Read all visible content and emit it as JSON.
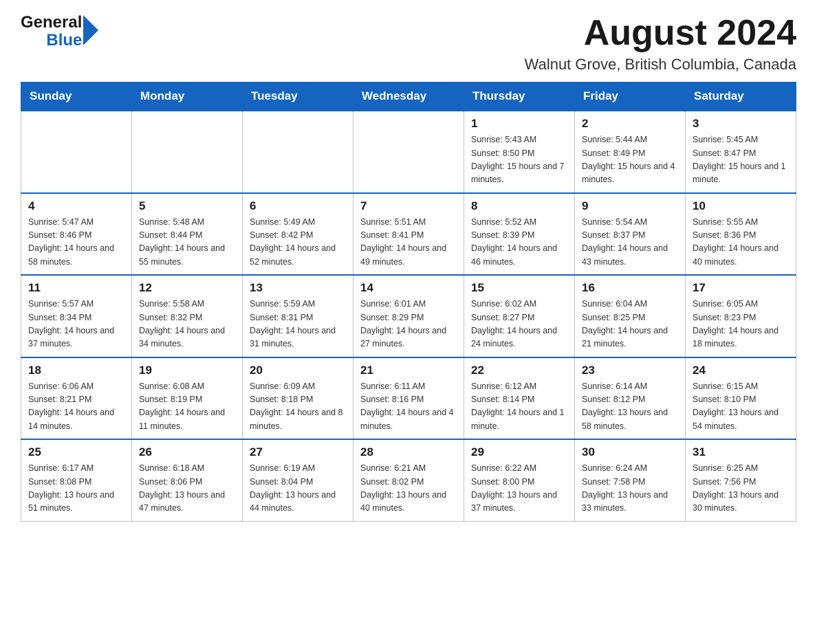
{
  "header": {
    "logo_text_general": "General",
    "logo_text_blue": "Blue",
    "title": "August 2024",
    "subtitle": "Walnut Grove, British Columbia, Canada"
  },
  "days_of_week": [
    "Sunday",
    "Monday",
    "Tuesday",
    "Wednesday",
    "Thursday",
    "Friday",
    "Saturday"
  ],
  "weeks": [
    {
      "days": [
        {
          "num": "",
          "info": "",
          "empty": true
        },
        {
          "num": "",
          "info": "",
          "empty": true
        },
        {
          "num": "",
          "info": "",
          "empty": true
        },
        {
          "num": "",
          "info": "",
          "empty": true
        },
        {
          "num": "1",
          "info": "Sunrise: 5:43 AM\nSunset: 8:50 PM\nDaylight: 15 hours and 7 minutes.",
          "empty": false
        },
        {
          "num": "2",
          "info": "Sunrise: 5:44 AM\nSunset: 8:49 PM\nDaylight: 15 hours and 4 minutes.",
          "empty": false
        },
        {
          "num": "3",
          "info": "Sunrise: 5:45 AM\nSunset: 8:47 PM\nDaylight: 15 hours and 1 minute.",
          "empty": false
        }
      ]
    },
    {
      "days": [
        {
          "num": "4",
          "info": "Sunrise: 5:47 AM\nSunset: 8:46 PM\nDaylight: 14 hours and 58 minutes.",
          "empty": false
        },
        {
          "num": "5",
          "info": "Sunrise: 5:48 AM\nSunset: 8:44 PM\nDaylight: 14 hours and 55 minutes.",
          "empty": false
        },
        {
          "num": "6",
          "info": "Sunrise: 5:49 AM\nSunset: 8:42 PM\nDaylight: 14 hours and 52 minutes.",
          "empty": false
        },
        {
          "num": "7",
          "info": "Sunrise: 5:51 AM\nSunset: 8:41 PM\nDaylight: 14 hours and 49 minutes.",
          "empty": false
        },
        {
          "num": "8",
          "info": "Sunrise: 5:52 AM\nSunset: 8:39 PM\nDaylight: 14 hours and 46 minutes.",
          "empty": false
        },
        {
          "num": "9",
          "info": "Sunrise: 5:54 AM\nSunset: 8:37 PM\nDaylight: 14 hours and 43 minutes.",
          "empty": false
        },
        {
          "num": "10",
          "info": "Sunrise: 5:55 AM\nSunset: 8:36 PM\nDaylight: 14 hours and 40 minutes.",
          "empty": false
        }
      ]
    },
    {
      "days": [
        {
          "num": "11",
          "info": "Sunrise: 5:57 AM\nSunset: 8:34 PM\nDaylight: 14 hours and 37 minutes.",
          "empty": false
        },
        {
          "num": "12",
          "info": "Sunrise: 5:58 AM\nSunset: 8:32 PM\nDaylight: 14 hours and 34 minutes.",
          "empty": false
        },
        {
          "num": "13",
          "info": "Sunrise: 5:59 AM\nSunset: 8:31 PM\nDaylight: 14 hours and 31 minutes.",
          "empty": false
        },
        {
          "num": "14",
          "info": "Sunrise: 6:01 AM\nSunset: 8:29 PM\nDaylight: 14 hours and 27 minutes.",
          "empty": false
        },
        {
          "num": "15",
          "info": "Sunrise: 6:02 AM\nSunset: 8:27 PM\nDaylight: 14 hours and 24 minutes.",
          "empty": false
        },
        {
          "num": "16",
          "info": "Sunrise: 6:04 AM\nSunset: 8:25 PM\nDaylight: 14 hours and 21 minutes.",
          "empty": false
        },
        {
          "num": "17",
          "info": "Sunrise: 6:05 AM\nSunset: 8:23 PM\nDaylight: 14 hours and 18 minutes.",
          "empty": false
        }
      ]
    },
    {
      "days": [
        {
          "num": "18",
          "info": "Sunrise: 6:06 AM\nSunset: 8:21 PM\nDaylight: 14 hours and 14 minutes.",
          "empty": false
        },
        {
          "num": "19",
          "info": "Sunrise: 6:08 AM\nSunset: 8:19 PM\nDaylight: 14 hours and 11 minutes.",
          "empty": false
        },
        {
          "num": "20",
          "info": "Sunrise: 6:09 AM\nSunset: 8:18 PM\nDaylight: 14 hours and 8 minutes.",
          "empty": false
        },
        {
          "num": "21",
          "info": "Sunrise: 6:11 AM\nSunset: 8:16 PM\nDaylight: 14 hours and 4 minutes.",
          "empty": false
        },
        {
          "num": "22",
          "info": "Sunrise: 6:12 AM\nSunset: 8:14 PM\nDaylight: 14 hours and 1 minute.",
          "empty": false
        },
        {
          "num": "23",
          "info": "Sunrise: 6:14 AM\nSunset: 8:12 PM\nDaylight: 13 hours and 58 minutes.",
          "empty": false
        },
        {
          "num": "24",
          "info": "Sunrise: 6:15 AM\nSunset: 8:10 PM\nDaylight: 13 hours and 54 minutes.",
          "empty": false
        }
      ]
    },
    {
      "days": [
        {
          "num": "25",
          "info": "Sunrise: 6:17 AM\nSunset: 8:08 PM\nDaylight: 13 hours and 51 minutes.",
          "empty": false
        },
        {
          "num": "26",
          "info": "Sunrise: 6:18 AM\nSunset: 8:06 PM\nDaylight: 13 hours and 47 minutes.",
          "empty": false
        },
        {
          "num": "27",
          "info": "Sunrise: 6:19 AM\nSunset: 8:04 PM\nDaylight: 13 hours and 44 minutes.",
          "empty": false
        },
        {
          "num": "28",
          "info": "Sunrise: 6:21 AM\nSunset: 8:02 PM\nDaylight: 13 hours and 40 minutes.",
          "empty": false
        },
        {
          "num": "29",
          "info": "Sunrise: 6:22 AM\nSunset: 8:00 PM\nDaylight: 13 hours and 37 minutes.",
          "empty": false
        },
        {
          "num": "30",
          "info": "Sunrise: 6:24 AM\nSunset: 7:58 PM\nDaylight: 13 hours and 33 minutes.",
          "empty": false
        },
        {
          "num": "31",
          "info": "Sunrise: 6:25 AM\nSunset: 7:56 PM\nDaylight: 13 hours and 30 minutes.",
          "empty": false
        }
      ]
    }
  ]
}
